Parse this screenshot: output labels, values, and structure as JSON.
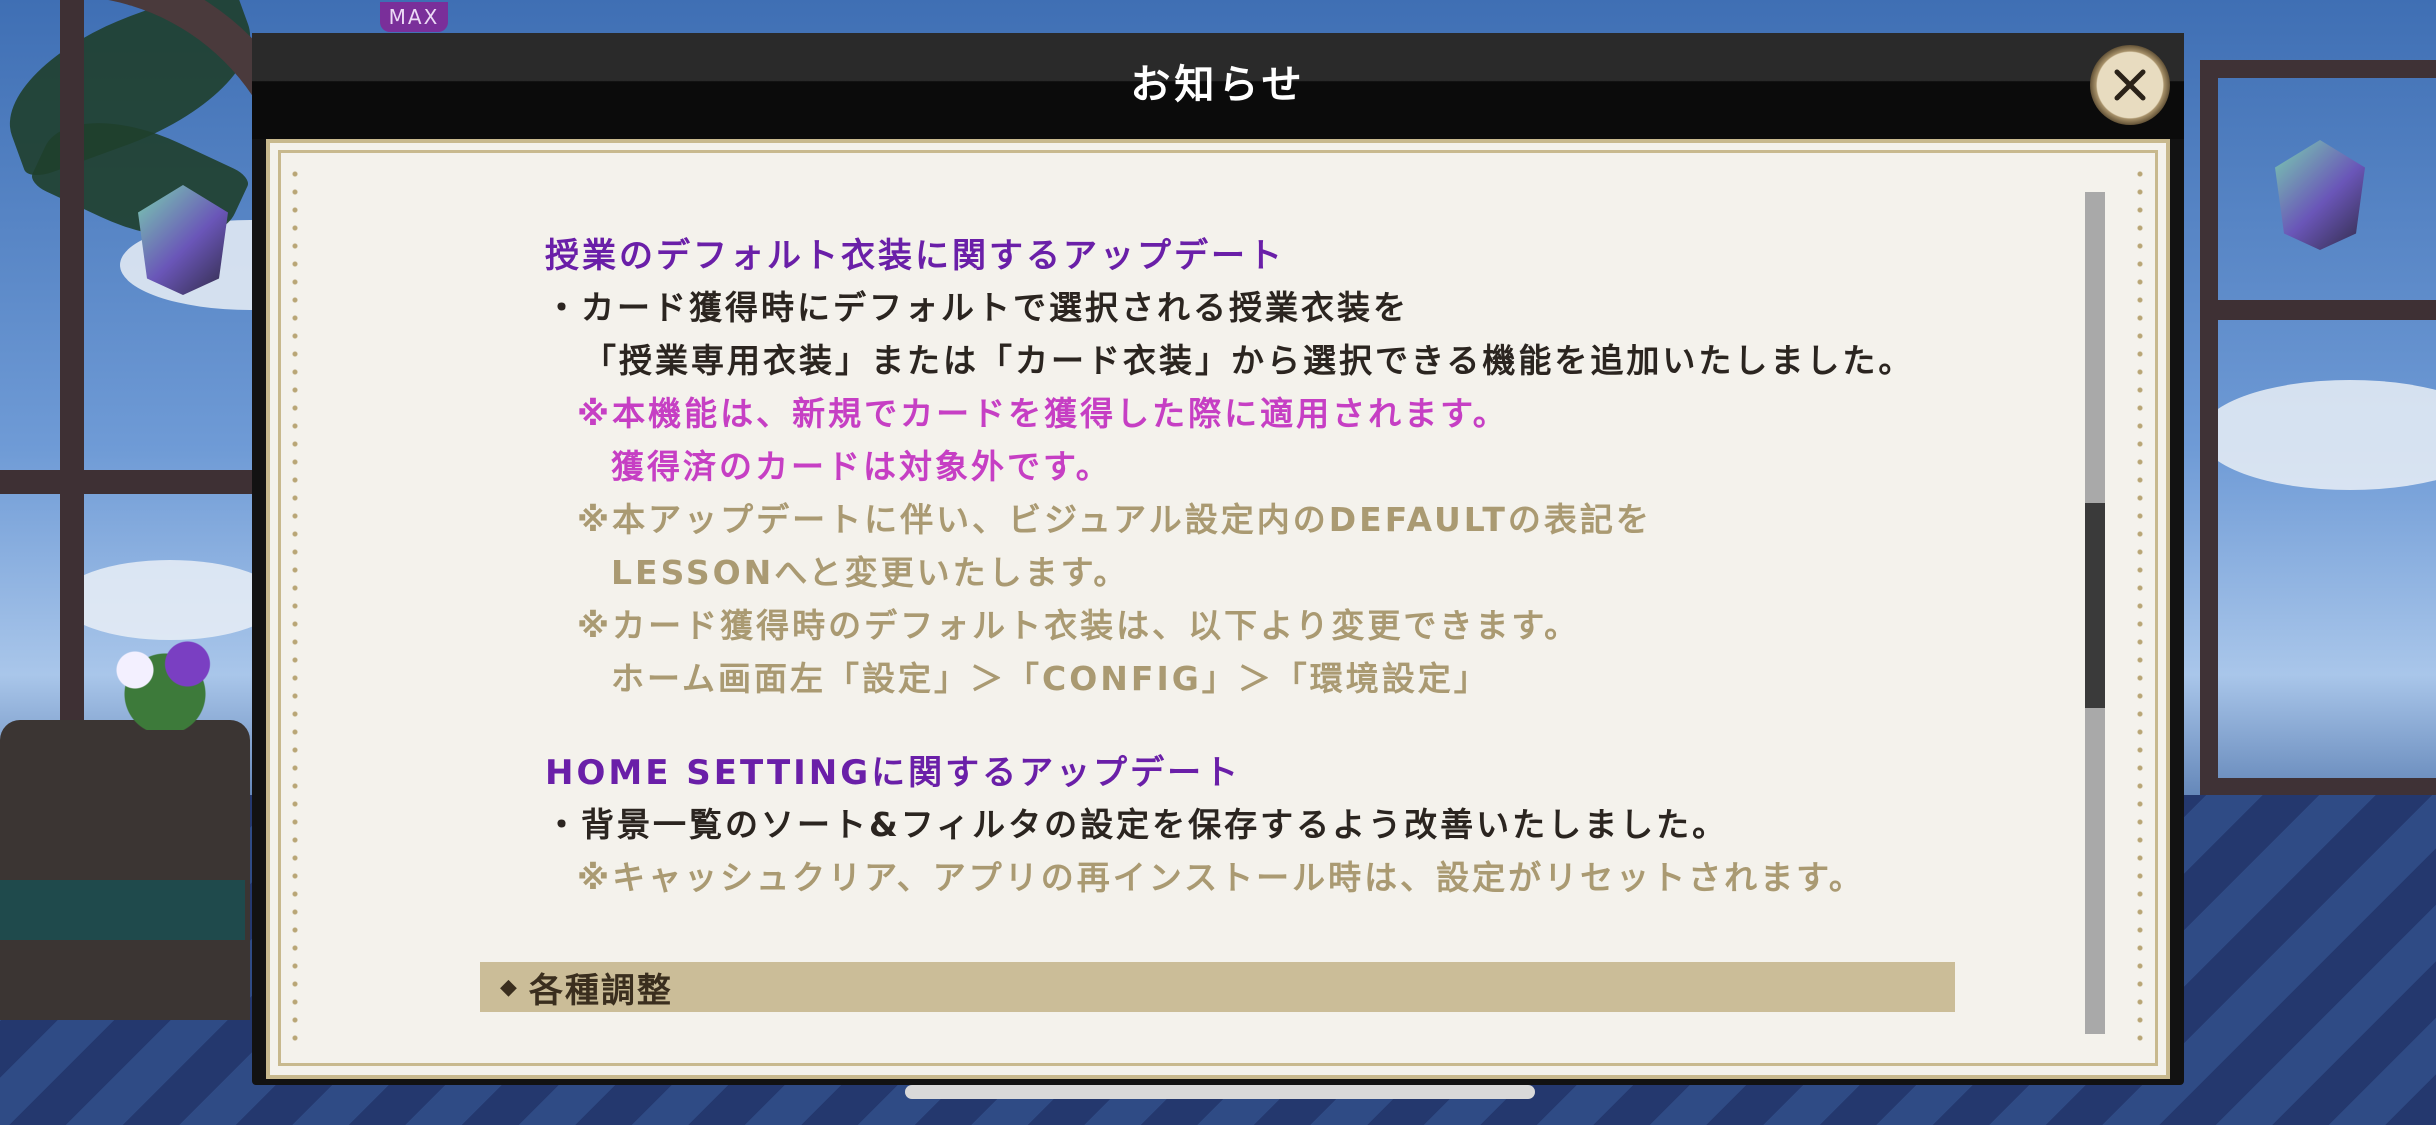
{
  "hud": {
    "max_badge": "MAX"
  },
  "dialog": {
    "title": "お知らせ",
    "close_icon": "close-icon"
  },
  "notice": {
    "section1": {
      "title": "授業のデフォルト衣装に関するアップデート",
      "line1": "・カード獲得時にデフォルトで選択される授業衣装を",
      "line2": "「授業専用衣装」または「カード衣装」から選択できる機能を追加いたしました。",
      "note1a": "※本機能は、新規でカードを獲得した際に適用されます。",
      "note1b": "獲得済のカードは対象外です。",
      "note2a": "※本アップデートに伴い、ビジュアル設定内のDEFAULTの表記を",
      "note2b": "LESSONへと変更いたします。",
      "note3a": "※カード獲得時のデフォルト衣装は、以下より変更できます。",
      "note3b": "ホーム画面左「設定」＞「CONFIG」＞「環境設定」"
    },
    "section2": {
      "title": "HOME SETTINGに関するアップデート",
      "line1": "・背景一覧のソート&フィルタの設定を保存するよう改善いたしました。",
      "note1": "※キャッシュクリア、アプリの再インストール時は、設定がリセットされます。"
    },
    "banner": {
      "icon": "diamond-icon",
      "label": "各種調整"
    }
  },
  "colors": {
    "section_title": "#6a1fa8",
    "body_text": "#2b2520",
    "highlight_note": "#c63fc4",
    "muted_note": "#aa9a72",
    "banner_bg": "#cbbd98",
    "paper": "#f4f2ec"
  }
}
